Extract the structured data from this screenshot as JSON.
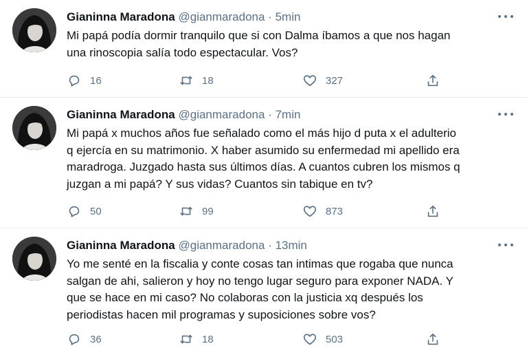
{
  "colors": {
    "secondary_text": "#5b7083",
    "primary_text": "#0f1419",
    "divider": "#e6ecf0"
  },
  "icons": {
    "reply": "speech-bubble-icon",
    "retweet": "retweet-arrows-icon",
    "like": "heart-icon",
    "share": "share-upload-icon",
    "more": "three-dots-icon"
  },
  "tweets": [
    {
      "name": "Gianinna Maradona",
      "handle": "@gianmaradona",
      "separator": "·",
      "time": "5min",
      "text": "Mi papá podía dormir tranquilo que si con Dalma íbamos a que nos hagan\nuna rinoscopia salía todo espectacular. Vos?",
      "replies": "16",
      "retweets": "18",
      "likes": "327"
    },
    {
      "name": "Gianinna Maradona",
      "handle": "@gianmaradona",
      "separator": "·",
      "time": "7min",
      "text": "Mi papá x muchos años fue señalado como el más hijo d puta x el adulterio\nq ejercía en su matrimonio. X haber asumido su enfermedad mi apellido era\nmaradroga. Juzgado hasta sus últimos días. A cuantos cubren los mismos q\njuzgan a mi papá? Y sus vidas? Cuantos sin tabique en tv?",
      "replies": "50",
      "retweets": "99",
      "likes": "873"
    },
    {
      "name": "Gianinna Maradona",
      "handle": "@gianmaradona",
      "separator": "·",
      "time": "13min",
      "text": "Yo me senté en la fiscalia y conte cosas tan intimas que rogaba que nunca\nsalgan de ahi, salieron y hoy no tengo lugar seguro para exponer NADA. Y\nque se hace en mi caso? No colaboras con la justicia xq después los\nperiodistas hacen mil programas y suposiciones sobre vos?",
      "replies": "36",
      "retweets": "18",
      "likes": "503"
    }
  ]
}
